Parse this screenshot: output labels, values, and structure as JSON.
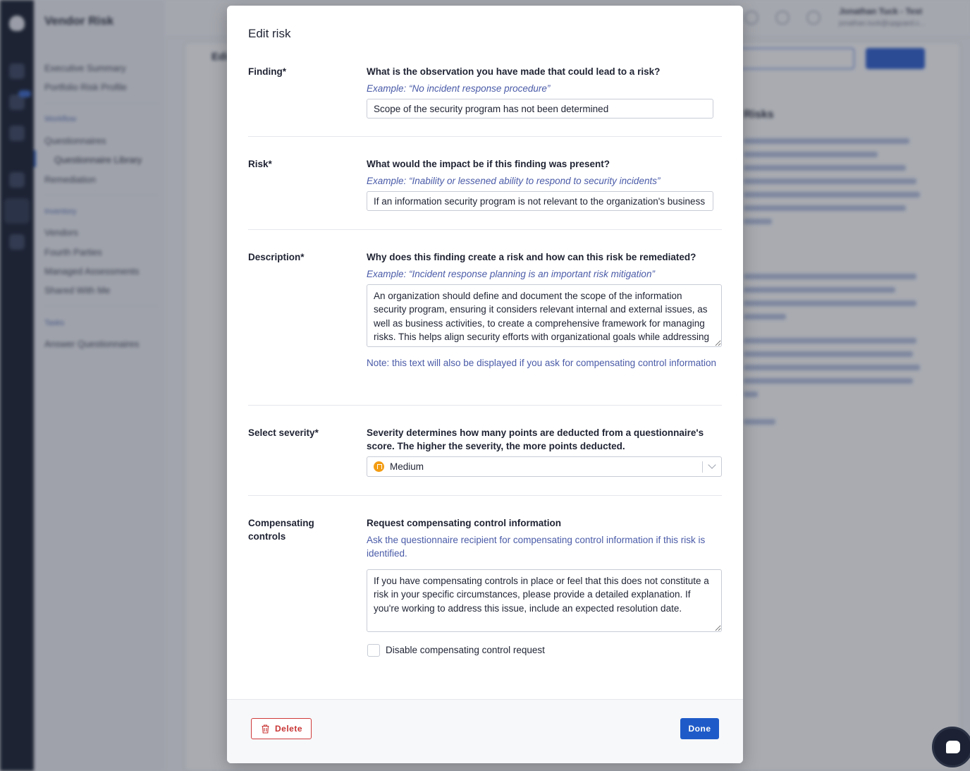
{
  "background": {
    "app_title": "Vendor Risk",
    "nav": {
      "items_top": [
        "Executive Summary",
        "Portfolio Risk Profile"
      ],
      "section_workflow": "Workflow",
      "items_workflow": [
        "Questionnaires",
        "Questionnaire Library",
        "Remediation"
      ],
      "section_inventory": "Inventory",
      "items_inventory": [
        "Vendors",
        "Fourth Parties",
        "Managed Assessments",
        "Shared With Me"
      ],
      "section_tasks": "Tasks",
      "items_tasks": [
        "Answer Questionnaires"
      ]
    },
    "user": {
      "name": "Jonathan Tuck - Test",
      "email": "jonathan.tuck@upguard.c..."
    },
    "page_heading": "Edi",
    "side_title": "Risks"
  },
  "modal": {
    "title": "Edit risk",
    "finding": {
      "label": "Finding*",
      "question": "What is the observation you have made that could lead to a risk?",
      "example": "Example: “No incident response procedure”",
      "value": "Scope of the security program has not been determined"
    },
    "risk": {
      "label": "Risk*",
      "question": "What would the impact be if this finding was present?",
      "example": "Example: “Inability or lessened ability to respond to security incidents”",
      "value": "If an information security program is not relevant to the organization's business needs, it may fail"
    },
    "description": {
      "label": "Description*",
      "question": "Why does this finding create a risk and how can this risk be remediated?",
      "example": "Example: “Incident response planning is an important risk mitigation”",
      "value": "An organization should define and document the scope of the information security program, ensuring it considers relevant internal and external issues, as well as business activities, to create a comprehensive framework for managing risks. This helps align security efforts with organizational goals while addressing unique organizational risks.",
      "note": "Note: this text will also be displayed if you ask for compensating control information"
    },
    "severity": {
      "label": "Select severity*",
      "help": "Severity determines how many points are deducted from a questionnaire's score. The higher the severity, the more points deducted.",
      "selected": "Medium",
      "color": "#f39c12"
    },
    "compensating": {
      "label": "Compensating controls",
      "heading": "Request compensating control information",
      "help": "Ask the questionnaire recipient for compensating control information if this risk is identified.",
      "value": "If you have compensating controls in place or feel that this does not constitute a risk in your specific circumstances, please provide a detailed explanation. If you're working to address this issue, include an expected resolution date.",
      "disable_label": "Disable compensating control request"
    },
    "footer": {
      "delete_label": "Delete",
      "done_label": "Done"
    }
  }
}
